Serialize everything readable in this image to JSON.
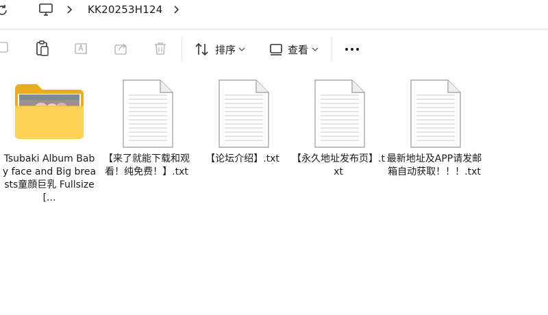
{
  "addressbar": {
    "breadcrumb": [
      {
        "label": "KK20253H124"
      }
    ]
  },
  "toolbar": {
    "sort_label": "排序",
    "view_label": "查看",
    "more_label": "..."
  },
  "files": [
    {
      "name": "Tsubaki Album Baby face and Big breasts童顔巨乳 Fullsize [...",
      "type": "folder"
    },
    {
      "name": "【来了就能下载和观看！纯免费！】.txt",
      "type": "txt"
    },
    {
      "name": "【论坛介绍】.txt",
      "type": "txt"
    },
    {
      "name": "【永久地址发布页】.txt",
      "type": "txt"
    },
    {
      "name": "最新地址及APP请发邮箱自动获取！！！.txt",
      "type": "txt"
    }
  ]
}
